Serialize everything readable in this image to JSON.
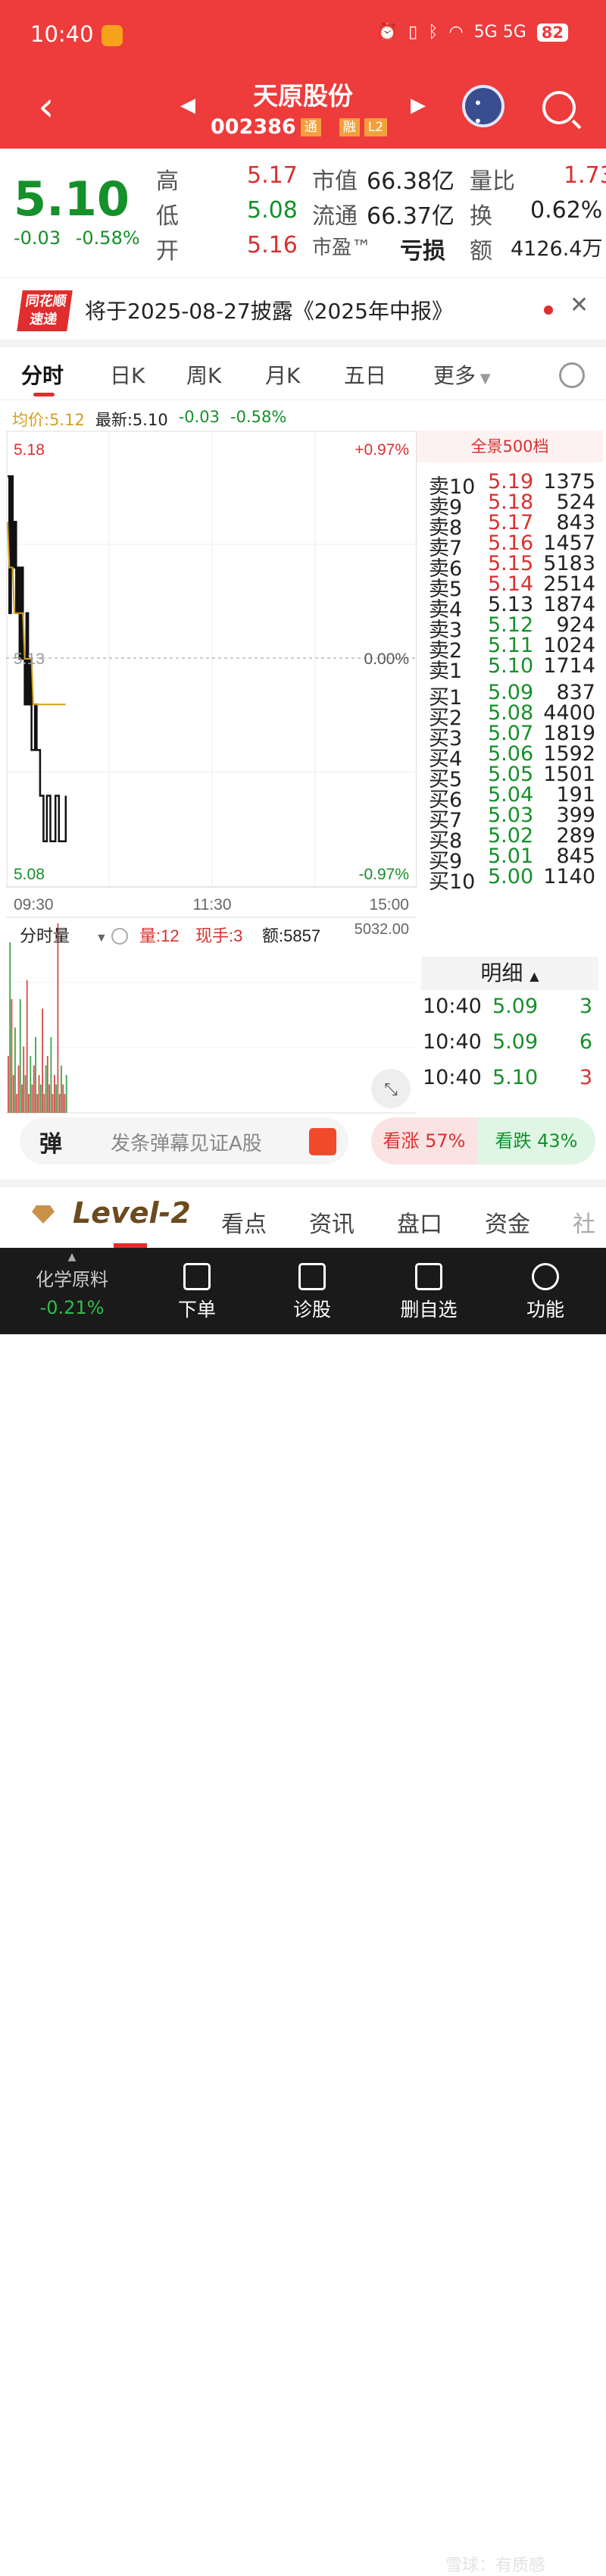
{
  "status_bar": {
    "time": "10:40",
    "signal": "5G 5G",
    "battery": "82"
  },
  "header": {
    "stock_name": "天原股份",
    "stock_code": "002386",
    "tags": [
      "通",
      "融",
      "L2"
    ]
  },
  "quote": {
    "price": "5.10",
    "change": "-0.03",
    "change_pct": "-0.58%",
    "high_label": "高",
    "high": "5.17",
    "low_label": "低",
    "low": "5.08",
    "open_label": "开",
    "open": "5.16",
    "mcap_label": "市值",
    "mcap": "66.38亿",
    "float_label": "流通",
    "float": "66.37亿",
    "pe_label": "市盈™",
    "pe": "亏损",
    "vol_ratio_label": "量比",
    "vol_ratio": "1.73",
    "turnover_label": "换",
    "turnover": "0.62%",
    "amount_label": "额",
    "amount": "4126.4万"
  },
  "notice": {
    "logo_line1": "同花顺",
    "logo_line2": "速递",
    "text": "将于2025-08-27披露《2025年中报》"
  },
  "tabs": {
    "active": "分时",
    "items": [
      "日K",
      "周K",
      "月K",
      "五日",
      "更多"
    ]
  },
  "legend": {
    "avg": "均价:5.12",
    "latest": "最新:5.10",
    "chg": "-0.03",
    "pct": "-0.58%"
  },
  "chart_data": {
    "type": "line",
    "title": "",
    "y_max_label": "5.18",
    "y_mid_label": "5.13",
    "y_min_label": "5.08",
    "pct_max_label": "+0.97%",
    "pct_mid_label": "0.00%",
    "pct_min_label": "-0.97%",
    "x_labels": [
      "09:30",
      "11:30",
      "15:00"
    ],
    "ylim": [
      5.08,
      5.18
    ],
    "series": [
      {
        "values": [
          5.17,
          5.14,
          5.17,
          5.15,
          5.16,
          5.14,
          5.15,
          5.13,
          5.15,
          5.13,
          5.12,
          5.14,
          5.12,
          5.13,
          5.11,
          5.11,
          5.12,
          5.11,
          5.11,
          5.1,
          5.1,
          5.09,
          5.09,
          5.1,
          5.1,
          5.09,
          5.09,
          5.09,
          5.1,
          5.1,
          5.09,
          5.09,
          5.09,
          5.09,
          5.1
        ]
      },
      {
        "values": [
          5.16,
          5.15,
          5.15,
          5.15,
          5.14,
          5.14,
          5.14,
          5.14,
          5.14,
          5.14,
          5.13,
          5.13,
          5.13,
          5.13,
          5.13,
          5.12,
          5.12,
          5.12,
          5.12,
          5.12,
          5.12,
          5.12,
          5.12,
          5.12,
          5.12,
          5.12,
          5.12,
          5.12,
          5.12,
          5.12,
          5.12,
          5.12,
          5.12,
          5.12,
          5.12
        ]
      }
    ],
    "volume": {
      "label": "分时量",
      "vol": "量:12",
      "hand": "现手:3",
      "amt": "额:5857",
      "max": "5032.00",
      "values": [
        30,
        90,
        60,
        20,
        45,
        10,
        25,
        60,
        15,
        35,
        20,
        70,
        10,
        30,
        15,
        25,
        40,
        10,
        20,
        15,
        55,
        10,
        25,
        30,
        15,
        40,
        10,
        20,
        15,
        100,
        10,
        25,
        15,
        10,
        20
      ]
    }
  },
  "orderbook": {
    "title": "全景500档",
    "sell": [
      {
        "label": "卖10",
        "price": "5.19",
        "vol": "1375"
      },
      {
        "label": "卖9",
        "price": "5.18",
        "vol": "524"
      },
      {
        "label": "卖8",
        "price": "5.17",
        "vol": "843"
      },
      {
        "label": "卖7",
        "price": "5.16",
        "vol": "1457"
      },
      {
        "label": "卖6",
        "price": "5.15",
        "vol": "5183"
      },
      {
        "label": "卖5",
        "price": "5.14",
        "vol": "2514"
      },
      {
        "label": "卖4",
        "price": "5.13",
        "vol": "1874"
      },
      {
        "label": "卖3",
        "price": "5.12",
        "vol": "924"
      },
      {
        "label": "卖2",
        "price": "5.11",
        "vol": "1024"
      },
      {
        "label": "卖1",
        "price": "5.10",
        "vol": "1714"
      }
    ],
    "buy": [
      {
        "label": "买1",
        "price": "5.09",
        "vol": "837"
      },
      {
        "label": "买2",
        "price": "5.08",
        "vol": "4400"
      },
      {
        "label": "买3",
        "price": "5.07",
        "vol": "1819"
      },
      {
        "label": "买4",
        "price": "5.06",
        "vol": "1592"
      },
      {
        "label": "买5",
        "price": "5.05",
        "vol": "1501"
      },
      {
        "label": "买6",
        "price": "5.04",
        "vol": "191"
      },
      {
        "label": "买7",
        "price": "5.03",
        "vol": "399"
      },
      {
        "label": "买8",
        "price": "5.02",
        "vol": "289"
      },
      {
        "label": "买9",
        "price": "5.01",
        "vol": "845"
      },
      {
        "label": "买10",
        "price": "5.00",
        "vol": "1140"
      }
    ]
  },
  "ticks": {
    "title": "明细",
    "rows": [
      {
        "time": "10:40",
        "price": "5.09",
        "vol": "3"
      },
      {
        "time": "10:40",
        "price": "5.09",
        "vol": "6"
      },
      {
        "time": "10:40",
        "price": "5.10",
        "vol": "3"
      }
    ]
  },
  "danmu": {
    "icon": "弹",
    "placeholder": "发条弹幕见证A股"
  },
  "vote": {
    "up": "看涨 57%",
    "down": "看跌 43%"
  },
  "level2": {
    "label": "Level-2",
    "tabs": [
      "看点",
      "资讯",
      "盘口",
      "资金",
      "社"
    ]
  },
  "bottom_nav": {
    "sector": "化学原料",
    "sector_pct": "-0.21%",
    "items": [
      "下单",
      "诊股",
      "删自选",
      "功能"
    ],
    "watermark": "雪球：有质感"
  },
  "colors": {
    "brand_red": "#ee3b3b",
    "up": "#d93030",
    "down": "#15902a",
    "avg_line": "#d4a017"
  }
}
